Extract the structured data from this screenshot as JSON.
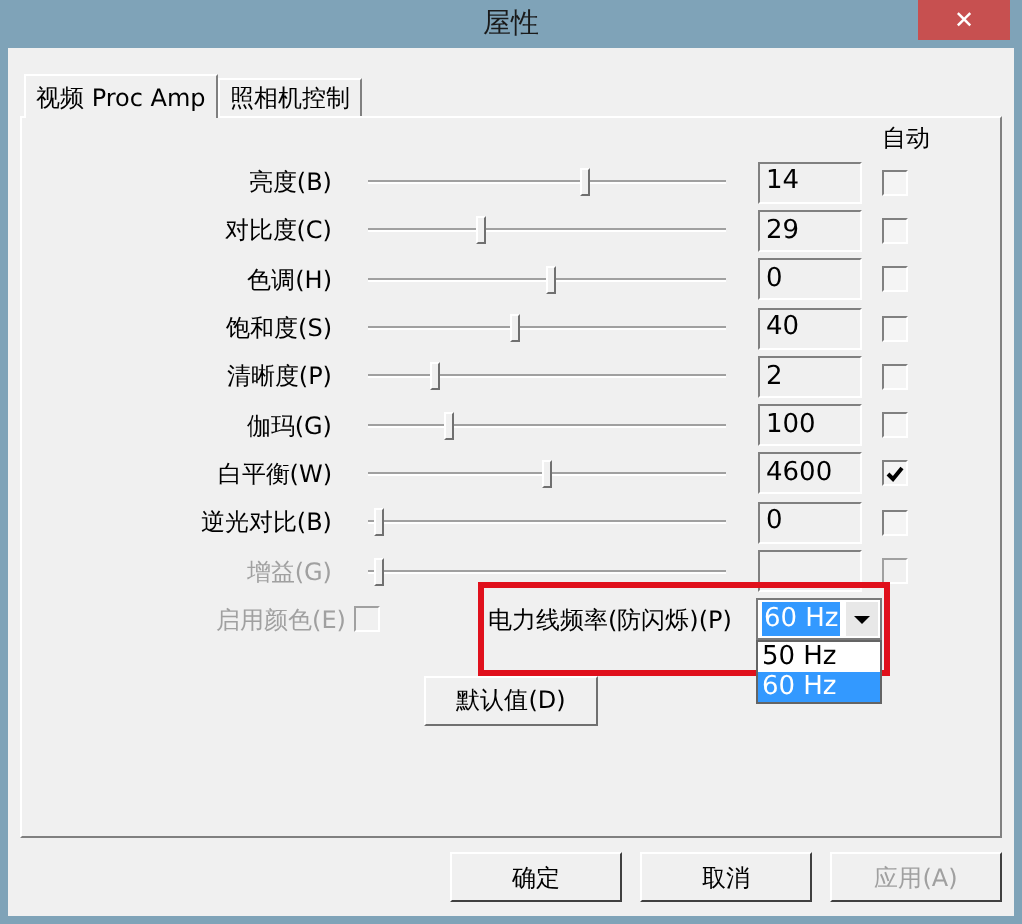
{
  "window": {
    "title": "屋性",
    "close": "✕"
  },
  "tabs": [
    {
      "label": "视频 Proc Amp",
      "selected": true
    },
    {
      "label": "照相机控制",
      "selected": false
    }
  ],
  "auto_header": "自动",
  "controls": [
    {
      "label": "亮度(B)",
      "level": 0.61,
      "value": "14",
      "auto": false,
      "disabled": false
    },
    {
      "label": "对比度(C)",
      "level": 0.31,
      "value": "29",
      "auto": false,
      "disabled": false
    },
    {
      "label": "色调(H)",
      "level": 0.51,
      "value": "0",
      "auto": false,
      "disabled": false
    },
    {
      "label": "饱和度(S)",
      "level": 0.41,
      "value": "40",
      "auto": false,
      "disabled": false
    },
    {
      "label": "清晰度(P)",
      "level": 0.18,
      "value": "2",
      "auto": false,
      "disabled": false
    },
    {
      "label": "伽玛(G)",
      "level": 0.22,
      "value": "100",
      "auto": false,
      "disabled": false
    },
    {
      "label": "白平衡(W)",
      "level": 0.5,
      "value": "4600",
      "auto": true,
      "disabled": false
    },
    {
      "label": "逆光对比(B)",
      "level": 0.02,
      "value": "0",
      "auto": false,
      "disabled": false
    },
    {
      "label": "增益(G)",
      "level": 0.02,
      "auto": false,
      "disabled": true
    }
  ],
  "enable_color": {
    "label": "启用颜色(E)",
    "checked": false,
    "disabled": true
  },
  "power_line": {
    "label": "电力线频率(防闪烁)(P)",
    "value": "60 Hz",
    "options": [
      {
        "label": "50 Hz",
        "selected": false
      },
      {
        "label": "60 Hz",
        "selected": true
      }
    ]
  },
  "default_button": "默认值(D)",
  "buttons": [
    {
      "label": "确定",
      "disabled": false
    },
    {
      "label": "取消",
      "disabled": false
    },
    {
      "label": "应用(A)",
      "disabled": true
    }
  ]
}
